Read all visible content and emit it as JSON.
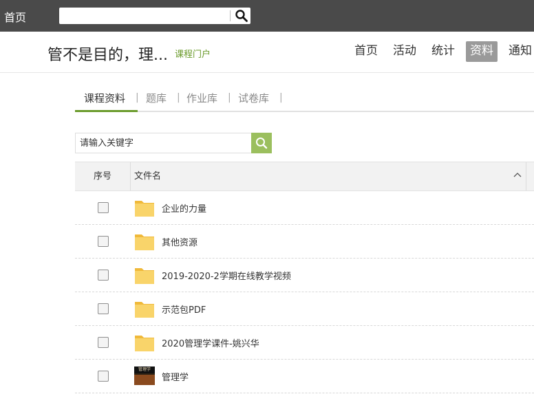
{
  "topbar": {
    "home_label": "首页",
    "search_placeholder": ""
  },
  "header": {
    "course_title": "管不是目的，理...",
    "portal_link": "课程门户",
    "nav": [
      {
        "label": "首页",
        "active": false
      },
      {
        "label": "活动",
        "active": false
      },
      {
        "label": "统计",
        "active": false
      },
      {
        "label": "资料",
        "active": true
      },
      {
        "label": "通知",
        "active": false
      }
    ]
  },
  "tabs": [
    {
      "label": "课程资料",
      "active": true
    },
    {
      "label": "题库",
      "active": false
    },
    {
      "label": "作业库",
      "active": false
    },
    {
      "label": "试卷库",
      "active": false
    }
  ],
  "tab_separator": "|",
  "filter": {
    "placeholder": "请输入关键字"
  },
  "table": {
    "columns": [
      "序号",
      "文件名"
    ],
    "rows": [
      {
        "name": "企业的力量",
        "type": "folder"
      },
      {
        "name": "其他资源",
        "type": "folder"
      },
      {
        "name": "2019-2020-2学期在线教学视频",
        "type": "folder"
      },
      {
        "name": "示范包PDF",
        "type": "folder"
      },
      {
        "name": "2020管理学课件-姚兴华",
        "type": "folder"
      },
      {
        "name": "管理学",
        "type": "book",
        "thumb_text": "管理学"
      }
    ]
  },
  "icons": {
    "search": "search-icon",
    "folder": "folder-icon",
    "sort": "chevron-up-icon"
  },
  "colors": {
    "topbar": "#4a4a4a",
    "accent_green": "#6a9a2a",
    "search_button": "#9bbf5e",
    "folder": "#f7c94b",
    "active_nav": "#9a9a9a"
  }
}
